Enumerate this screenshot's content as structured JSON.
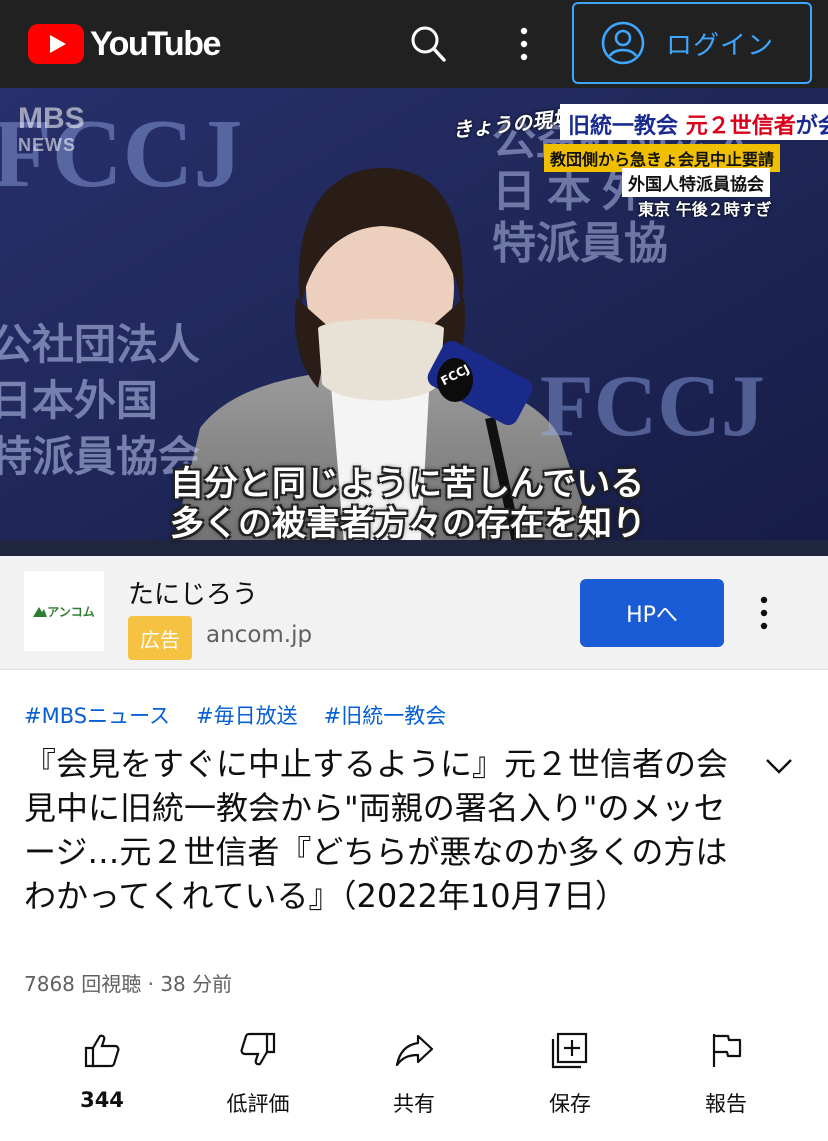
{
  "header": {
    "logo_text": "YouTube",
    "search_icon": "search-icon",
    "more_icon": "more-vert-icon",
    "login_label": "ログイン",
    "account_icon": "account-circle-icon",
    "brand_color": "#ff0000",
    "login_color": "#3ea6ff"
  },
  "video": {
    "watermark_top": "MBS",
    "watermark_bottom": "NEWS",
    "sign_left": "FCCJ",
    "sign_left_jp": [
      "公社団法人",
      "日本外国",
      "特派員協会"
    ],
    "sign_right": "FCCJ",
    "sign_right_jp": [
      "公益社団法人",
      "日 本 外",
      "特派員協"
    ],
    "mic_label": "FCCJ",
    "chyron": {
      "show": "きょうの現場",
      "title_part1": "旧統一教会",
      "title_part2": "元２世信者",
      "title_part3": "が会見",
      "sub1": "教団側から急きょ会見中止要請",
      "sub2": "外国人特派員協会",
      "time": "東京 午後２時すぎ"
    },
    "subtitle_line1": "自分と同じように苦しんでいる",
    "subtitle_line2": "多くの被害者方々の存在を知り"
  },
  "ad": {
    "logo_text": "アンコム",
    "title": "たにじろう",
    "badge": "広告",
    "domain": "ancom.jp",
    "cta": "HPへ",
    "more_icon": "more-vert-icon"
  },
  "hashtags": [
    "#MBSニュース",
    "#毎日放送",
    "#旧統一教会"
  ],
  "title": "『会見をすぐに中止するように』元２世信者の会見中に旧統一教会から\"両親の署名入り\"のメッセージ…元２世信者『どちらが悪なのか多くの方はわかってくれている』（2022年10月7日）",
  "meta": "7868 回視聴 · 38 分前",
  "actions": {
    "like_count": "344",
    "dislike_label": "低評価",
    "share_label": "共有",
    "save_label": "保存",
    "report_label": "報告"
  }
}
